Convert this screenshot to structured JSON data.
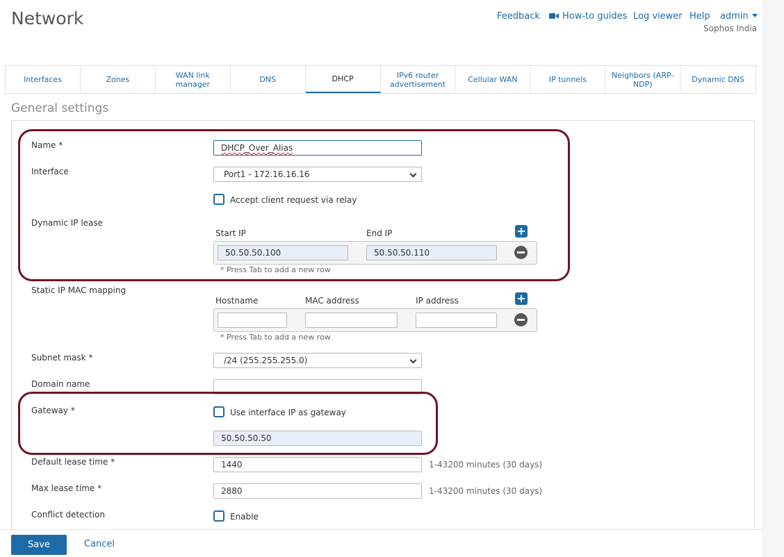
{
  "header": {
    "title": "Network",
    "links": {
      "feedback": "Feedback",
      "howto": "How-to guides",
      "log_viewer": "Log viewer",
      "help": "Help",
      "admin": "admin"
    },
    "org": "Sophos India"
  },
  "tabs": [
    {
      "label": "Interfaces"
    },
    {
      "label": "Zones"
    },
    {
      "label": "WAN link manager"
    },
    {
      "label": "DNS"
    },
    {
      "label": "DHCP",
      "active": true
    },
    {
      "label": "IPv6 router advertisement"
    },
    {
      "label": "Cellular WAN"
    },
    {
      "label": "IP tunnels"
    },
    {
      "label": "Neighbors (ARP-NDP)"
    },
    {
      "label": "Dynamic DNS"
    }
  ],
  "section": {
    "title": "General settings"
  },
  "form": {
    "name": {
      "label": "Name *",
      "value": "DHCP_Over_Alias"
    },
    "interface": {
      "label": "Interface",
      "value": "Port1 - 172.16.16.16"
    },
    "relay": {
      "label": "Accept client request via relay",
      "checked": false
    },
    "dynamic_lease": {
      "label": "Dynamic IP lease",
      "col_start": "Start IP",
      "col_end": "End IP",
      "start_ip": "50.50.50.100",
      "end_ip": "50.50.50.110",
      "hint": "* Press Tab to add a new row"
    },
    "static_mapping": {
      "label": "Static IP MAC mapping",
      "col_hostname": "Hostname",
      "col_mac": "MAC address",
      "col_ip": "IP address",
      "hostname": "",
      "mac": "",
      "ip": "",
      "hint": "* Press Tab to add a new row"
    },
    "subnet_mask": {
      "label": "Subnet mask *",
      "value": "/24 (255.255.255.0)"
    },
    "domain_name": {
      "label": "Domain name",
      "value": ""
    },
    "gateway": {
      "label": "Gateway *",
      "use_interface_label": "Use interface IP as gateway",
      "use_interface_checked": false,
      "value": "50.50.50.50"
    },
    "default_lease": {
      "label": "Default lease time *",
      "value": "1440",
      "range": "1-43200 minutes (30 days)"
    },
    "max_lease": {
      "label": "Max lease time *",
      "value": "2880",
      "range": "1-43200 minutes (30 days)"
    },
    "conflict": {
      "label": "Conflict detection",
      "enable_label": "Enable",
      "checked": false
    }
  },
  "footer": {
    "save": "Save",
    "cancel": "Cancel"
  },
  "colors": {
    "accent": "#1d6aa6",
    "annotation": "#6e1423",
    "filled_input": "#e8eef9"
  }
}
